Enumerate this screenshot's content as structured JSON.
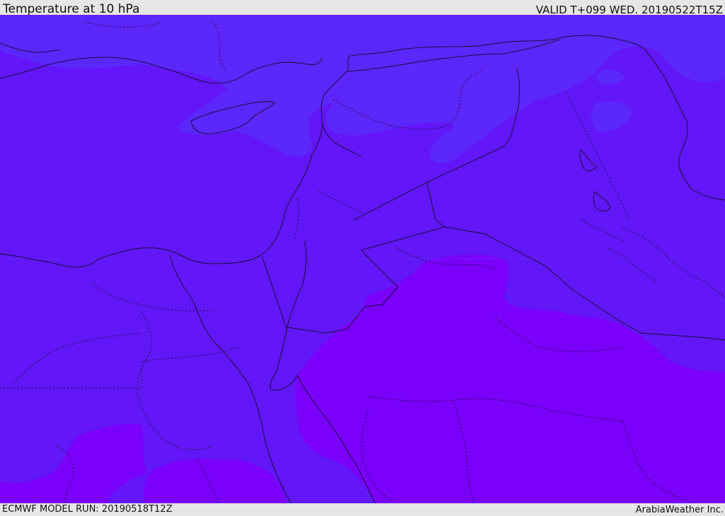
{
  "header": {
    "title": "Temperature at 10 hPa",
    "valid": "VALID T+099 WED. 20190522T15Z"
  },
  "footer": {
    "model_run": "ECMWF MODEL RUN: 20190518T12Z",
    "credit": "ArabiaWeather Inc."
  },
  "colors": {
    "band_warmer": "#5b27fb",
    "band_mid": "#6316f7",
    "band_colder": "#7a00fb",
    "coastline": "#1a0d3a",
    "border": "#1a0d3a",
    "frame_bg": "#e6e6e6"
  }
}
